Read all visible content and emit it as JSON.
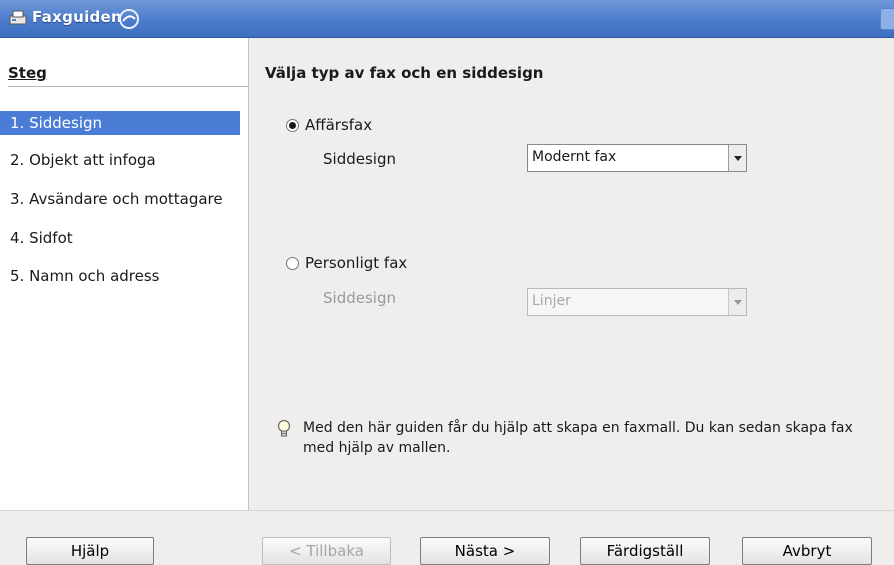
{
  "window": {
    "title": "Faxguiden"
  },
  "sidebar": {
    "heading": "Steg",
    "steps": [
      {
        "label": "1. Siddesign",
        "active": true
      },
      {
        "label": "2. Objekt att infoga"
      },
      {
        "label": "3. Avsändare och mottagare"
      },
      {
        "label": "4. Sidfot"
      },
      {
        "label": "5. Namn och adress"
      }
    ]
  },
  "main": {
    "heading": "Välja typ av fax och en siddesign",
    "business": {
      "label": "Affärsfax",
      "checked": true,
      "design_label": "Siddesign",
      "design_value": "Modernt fax"
    },
    "personal": {
      "label": "Personligt fax",
      "checked": false,
      "design_label": "Siddesign",
      "design_value": "Linjer"
    },
    "hint": "Med den här guiden får du hjälp att skapa en faxmall. Du kan sedan skapa fax med  hjälp av mallen."
  },
  "buttons": {
    "help": "Hjälp",
    "back": "< Tillbaka",
    "next": "Nästa >",
    "finish": "Färdigställ",
    "cancel": "Avbryt"
  },
  "colors": {
    "titlebar": "#4c7ccc",
    "selection": "#4a7cd6"
  }
}
